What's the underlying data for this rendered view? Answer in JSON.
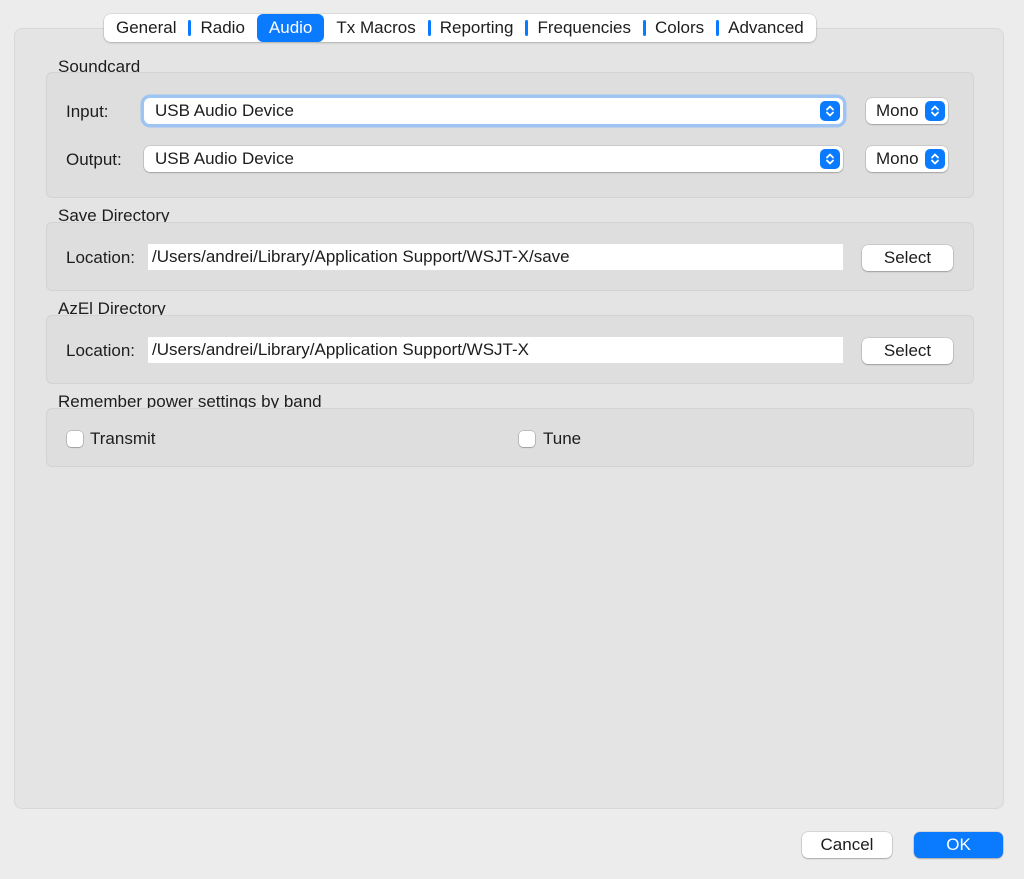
{
  "tabs": [
    "General",
    "Radio",
    "Audio",
    "Tx Macros",
    "Reporting",
    "Frequencies",
    "Colors",
    "Advanced"
  ],
  "active_tab": "Audio",
  "soundcard": {
    "title": "Soundcard",
    "input_label": "Input:",
    "input_device": "USB Audio Device",
    "input_channel": "Mono",
    "output_label": "Output:",
    "output_device": "USB Audio Device",
    "output_channel": "Mono"
  },
  "save_directory": {
    "title": "Save Directory",
    "location_label": "Location:",
    "path": "/Users/andrei/Library/Application Support/WSJT-X/save",
    "select_label": "Select"
  },
  "azel_directory": {
    "title": "AzEl Directory",
    "location_label": "Location:",
    "path": "/Users/andrei/Library/Application Support/WSJT-X",
    "select_label": "Select"
  },
  "power": {
    "title": "Remember power settings by band",
    "transmit_label": "Transmit",
    "transmit_checked": false,
    "tune_label": "Tune",
    "tune_checked": false
  },
  "footer": {
    "cancel_label": "Cancel",
    "ok_label": "OK"
  },
  "colors": {
    "accent": "#0a7aff",
    "window_bg": "#ececec",
    "group_bg": "#dedede"
  }
}
